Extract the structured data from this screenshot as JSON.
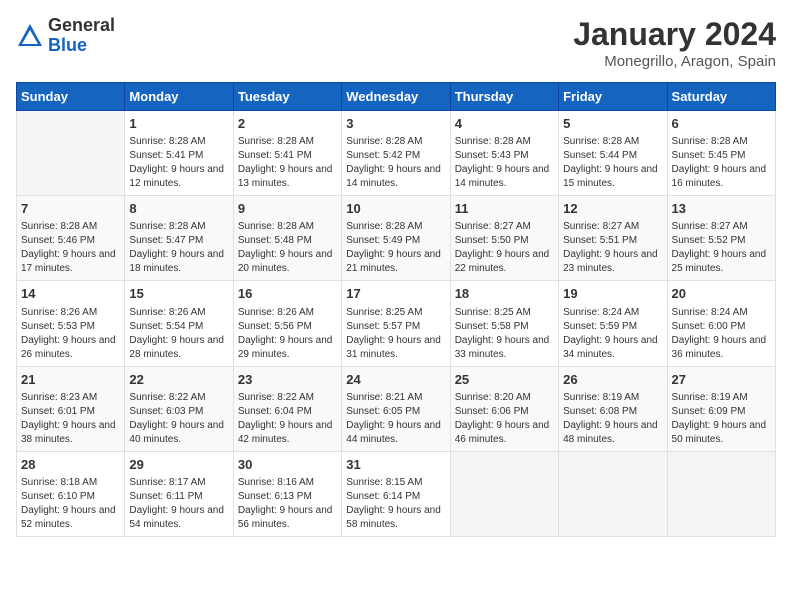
{
  "logo": {
    "general": "General",
    "blue": "Blue"
  },
  "title": "January 2024",
  "location": "Monegrillo, Aragon, Spain",
  "days_of_week": [
    "Sunday",
    "Monday",
    "Tuesday",
    "Wednesday",
    "Thursday",
    "Friday",
    "Saturday"
  ],
  "weeks": [
    [
      {
        "num": "",
        "sunrise": "",
        "sunset": "",
        "daylight": ""
      },
      {
        "num": "1",
        "sunrise": "Sunrise: 8:28 AM",
        "sunset": "Sunset: 5:41 PM",
        "daylight": "Daylight: 9 hours and 12 minutes."
      },
      {
        "num": "2",
        "sunrise": "Sunrise: 8:28 AM",
        "sunset": "Sunset: 5:41 PM",
        "daylight": "Daylight: 9 hours and 13 minutes."
      },
      {
        "num": "3",
        "sunrise": "Sunrise: 8:28 AM",
        "sunset": "Sunset: 5:42 PM",
        "daylight": "Daylight: 9 hours and 14 minutes."
      },
      {
        "num": "4",
        "sunrise": "Sunrise: 8:28 AM",
        "sunset": "Sunset: 5:43 PM",
        "daylight": "Daylight: 9 hours and 14 minutes."
      },
      {
        "num": "5",
        "sunrise": "Sunrise: 8:28 AM",
        "sunset": "Sunset: 5:44 PM",
        "daylight": "Daylight: 9 hours and 15 minutes."
      },
      {
        "num": "6",
        "sunrise": "Sunrise: 8:28 AM",
        "sunset": "Sunset: 5:45 PM",
        "daylight": "Daylight: 9 hours and 16 minutes."
      }
    ],
    [
      {
        "num": "7",
        "sunrise": "Sunrise: 8:28 AM",
        "sunset": "Sunset: 5:46 PM",
        "daylight": "Daylight: 9 hours and 17 minutes."
      },
      {
        "num": "8",
        "sunrise": "Sunrise: 8:28 AM",
        "sunset": "Sunset: 5:47 PM",
        "daylight": "Daylight: 9 hours and 18 minutes."
      },
      {
        "num": "9",
        "sunrise": "Sunrise: 8:28 AM",
        "sunset": "Sunset: 5:48 PM",
        "daylight": "Daylight: 9 hours and 20 minutes."
      },
      {
        "num": "10",
        "sunrise": "Sunrise: 8:28 AM",
        "sunset": "Sunset: 5:49 PM",
        "daylight": "Daylight: 9 hours and 21 minutes."
      },
      {
        "num": "11",
        "sunrise": "Sunrise: 8:27 AM",
        "sunset": "Sunset: 5:50 PM",
        "daylight": "Daylight: 9 hours and 22 minutes."
      },
      {
        "num": "12",
        "sunrise": "Sunrise: 8:27 AM",
        "sunset": "Sunset: 5:51 PM",
        "daylight": "Daylight: 9 hours and 23 minutes."
      },
      {
        "num": "13",
        "sunrise": "Sunrise: 8:27 AM",
        "sunset": "Sunset: 5:52 PM",
        "daylight": "Daylight: 9 hours and 25 minutes."
      }
    ],
    [
      {
        "num": "14",
        "sunrise": "Sunrise: 8:26 AM",
        "sunset": "Sunset: 5:53 PM",
        "daylight": "Daylight: 9 hours and 26 minutes."
      },
      {
        "num": "15",
        "sunrise": "Sunrise: 8:26 AM",
        "sunset": "Sunset: 5:54 PM",
        "daylight": "Daylight: 9 hours and 28 minutes."
      },
      {
        "num": "16",
        "sunrise": "Sunrise: 8:26 AM",
        "sunset": "Sunset: 5:56 PM",
        "daylight": "Daylight: 9 hours and 29 minutes."
      },
      {
        "num": "17",
        "sunrise": "Sunrise: 8:25 AM",
        "sunset": "Sunset: 5:57 PM",
        "daylight": "Daylight: 9 hours and 31 minutes."
      },
      {
        "num": "18",
        "sunrise": "Sunrise: 8:25 AM",
        "sunset": "Sunset: 5:58 PM",
        "daylight": "Daylight: 9 hours and 33 minutes."
      },
      {
        "num": "19",
        "sunrise": "Sunrise: 8:24 AM",
        "sunset": "Sunset: 5:59 PM",
        "daylight": "Daylight: 9 hours and 34 minutes."
      },
      {
        "num": "20",
        "sunrise": "Sunrise: 8:24 AM",
        "sunset": "Sunset: 6:00 PM",
        "daylight": "Daylight: 9 hours and 36 minutes."
      }
    ],
    [
      {
        "num": "21",
        "sunrise": "Sunrise: 8:23 AM",
        "sunset": "Sunset: 6:01 PM",
        "daylight": "Daylight: 9 hours and 38 minutes."
      },
      {
        "num": "22",
        "sunrise": "Sunrise: 8:22 AM",
        "sunset": "Sunset: 6:03 PM",
        "daylight": "Daylight: 9 hours and 40 minutes."
      },
      {
        "num": "23",
        "sunrise": "Sunrise: 8:22 AM",
        "sunset": "Sunset: 6:04 PM",
        "daylight": "Daylight: 9 hours and 42 minutes."
      },
      {
        "num": "24",
        "sunrise": "Sunrise: 8:21 AM",
        "sunset": "Sunset: 6:05 PM",
        "daylight": "Daylight: 9 hours and 44 minutes."
      },
      {
        "num": "25",
        "sunrise": "Sunrise: 8:20 AM",
        "sunset": "Sunset: 6:06 PM",
        "daylight": "Daylight: 9 hours and 46 minutes."
      },
      {
        "num": "26",
        "sunrise": "Sunrise: 8:19 AM",
        "sunset": "Sunset: 6:08 PM",
        "daylight": "Daylight: 9 hours and 48 minutes."
      },
      {
        "num": "27",
        "sunrise": "Sunrise: 8:19 AM",
        "sunset": "Sunset: 6:09 PM",
        "daylight": "Daylight: 9 hours and 50 minutes."
      }
    ],
    [
      {
        "num": "28",
        "sunrise": "Sunrise: 8:18 AM",
        "sunset": "Sunset: 6:10 PM",
        "daylight": "Daylight: 9 hours and 52 minutes."
      },
      {
        "num": "29",
        "sunrise": "Sunrise: 8:17 AM",
        "sunset": "Sunset: 6:11 PM",
        "daylight": "Daylight: 9 hours and 54 minutes."
      },
      {
        "num": "30",
        "sunrise": "Sunrise: 8:16 AM",
        "sunset": "Sunset: 6:13 PM",
        "daylight": "Daylight: 9 hours and 56 minutes."
      },
      {
        "num": "31",
        "sunrise": "Sunrise: 8:15 AM",
        "sunset": "Sunset: 6:14 PM",
        "daylight": "Daylight: 9 hours and 58 minutes."
      },
      {
        "num": "",
        "sunrise": "",
        "sunset": "",
        "daylight": ""
      },
      {
        "num": "",
        "sunrise": "",
        "sunset": "",
        "daylight": ""
      },
      {
        "num": "",
        "sunrise": "",
        "sunset": "",
        "daylight": ""
      }
    ]
  ]
}
